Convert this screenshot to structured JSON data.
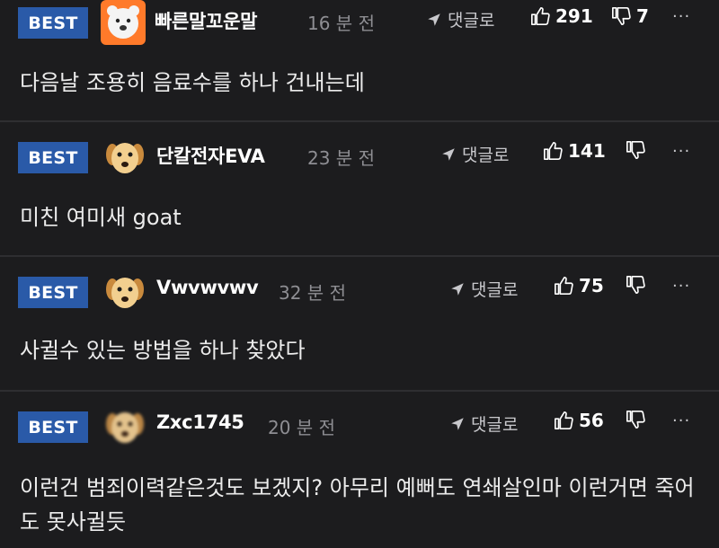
{
  "comments": [
    {
      "badge": "BEST",
      "username": "빠른말꼬운말",
      "time": "16 분 전",
      "reply_label": "댓글로",
      "likes": "291",
      "dislikes": "7",
      "more": "···",
      "text": "다음날 조용히 음료수를 하나 건내는데",
      "avatar": "polar-bear-avatar-icon"
    },
    {
      "badge": "BEST",
      "username": "단칼전자EVA",
      "time": "23 분 전",
      "reply_label": "댓글로",
      "likes": "141",
      "dislikes": "",
      "more": "···",
      "text": "미친 여미새 goat",
      "avatar": "puppy-avatar-icon"
    },
    {
      "badge": "BEST",
      "username": "Vwvwvwv",
      "time": "32 분 전",
      "reply_label": "댓글로",
      "likes": "75",
      "dislikes": "",
      "more": "···",
      "text": "사귈수 있는 방법을 하나 찾았다",
      "avatar": "puppy-avatar-icon"
    },
    {
      "badge": "BEST",
      "username": "Zxc1745",
      "time": "20 분 전",
      "reply_label": "댓글로",
      "likes": "56",
      "dislikes": "",
      "more": "···",
      "text": "이런건 범죄이력같은것도 보겠지? 아무리 예뻐도 연쇄살인마 이런거면 죽어도 못사귈듯",
      "avatar": "blurred-puppy-avatar-icon"
    }
  ],
  "colors": {
    "background": "#1c1c1e",
    "badge": "#2a5aa8",
    "meta": "#8e8e93"
  }
}
